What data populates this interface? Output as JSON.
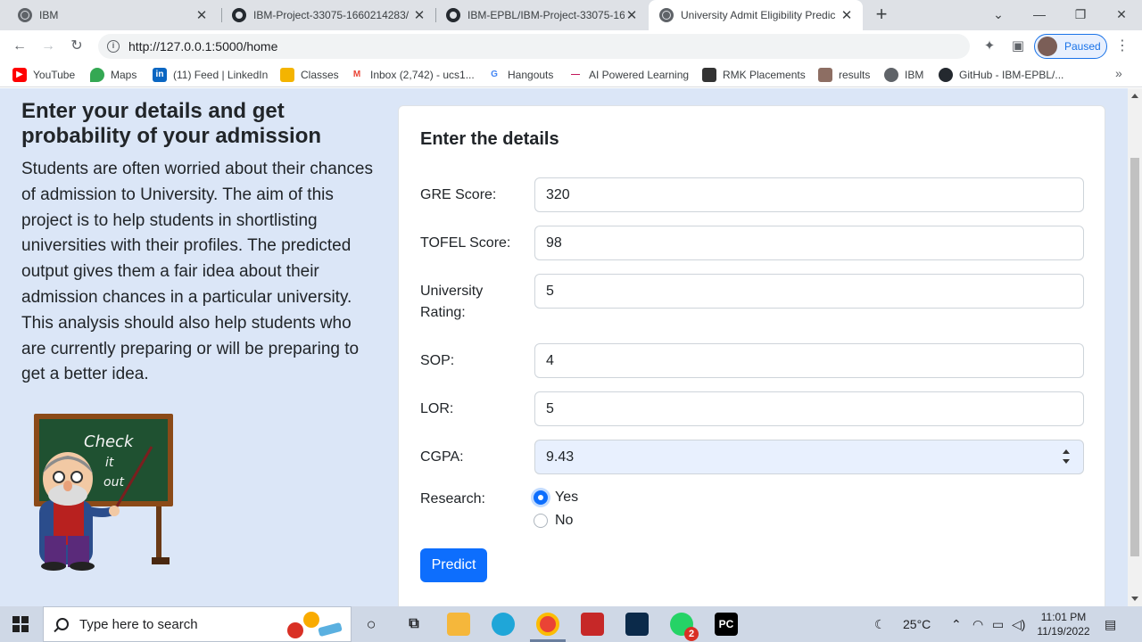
{
  "browser": {
    "tabs": [
      {
        "title": "IBM",
        "icon": "globe-icon",
        "active": false
      },
      {
        "title": "IBM-Project-33075-1660214283/",
        "icon": "github-icon",
        "active": false
      },
      {
        "title": "IBM-EPBL/IBM-Project-33075-16",
        "icon": "github-icon",
        "active": false
      },
      {
        "title": "University Admit Eligibility Predic",
        "icon": "globe-icon",
        "active": true
      }
    ],
    "url": "http://127.0.0.1:5000/home",
    "profile_label": "Paused",
    "bookmarks": [
      {
        "label": "YouTube",
        "color": "#ff0000"
      },
      {
        "label": "Maps",
        "color": "#34a853"
      },
      {
        "label": "(11) Feed | LinkedIn",
        "color": "#0a66c2"
      },
      {
        "label": "Classes",
        "color": "#f4b400"
      },
      {
        "label": "Inbox (2,742) - ucs1...",
        "color": "#ea4335"
      },
      {
        "label": "Hangouts",
        "color": "#4285f4"
      },
      {
        "label": "AI Powered Learning",
        "color": "#c2185b"
      },
      {
        "label": "RMK Placements",
        "color": "#333333"
      },
      {
        "label": "results",
        "color": "#8d6e63"
      },
      {
        "label": "IBM",
        "color": "#5f6368"
      },
      {
        "label": "GitHub - IBM-EPBL/...",
        "color": "#24292f"
      }
    ]
  },
  "page": {
    "heading": "Enter your details and get probability of your admission",
    "description": "Students are often worried about their chances of admission to University. The aim of this project is to help students in shortlisting universities with their profiles. The predicted output gives them a fair idea about their admission chances in a particular university. This analysis should also help students who are currently preparing or will be preparing to get a better idea.",
    "image_text": "Check it out",
    "form": {
      "title": "Enter the details",
      "gre": {
        "label": "GRE Score:",
        "value": "320"
      },
      "tofel": {
        "label": "TOFEL Score:",
        "value": "98"
      },
      "rating": {
        "label": "University Rating:",
        "value": "5"
      },
      "sop": {
        "label": "SOP:",
        "value": "4"
      },
      "lor": {
        "label": "LOR:",
        "value": "5"
      },
      "cgpa": {
        "label": "CGPA:",
        "value": "9.43"
      },
      "research": {
        "label": "Research:",
        "options": [
          "Yes",
          "No"
        ],
        "selected": "Yes"
      },
      "submit_label": "Predict"
    }
  },
  "taskbar": {
    "search_placeholder": "Type here to search",
    "weather": "25°C",
    "time": "11:01 PM",
    "date": "11/19/2022",
    "whatsapp_badge": "2",
    "pycharm_label": "PC"
  },
  "colors": {
    "accent": "#0d6efd",
    "page_bg": "#dbe6f7"
  }
}
